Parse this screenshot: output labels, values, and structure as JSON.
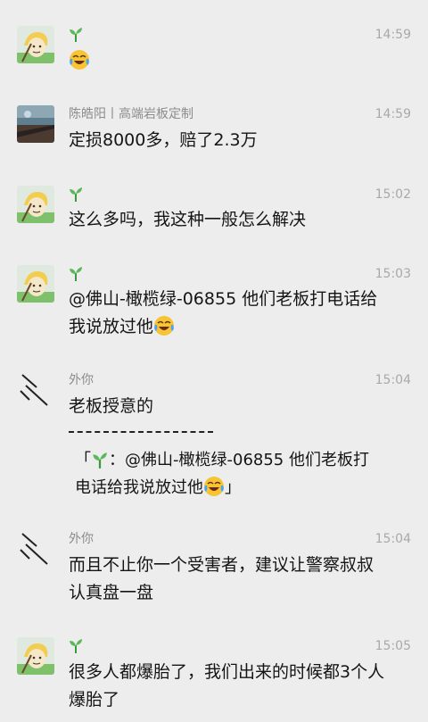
{
  "messages": [
    {
      "avatar": "farmer-avatar",
      "name_icon": "sprout-icon",
      "time": "14:59",
      "text": "",
      "emoji_only": true
    },
    {
      "avatar": "photo-avatar",
      "name": "陈皓阳丨高端岩板定制",
      "time": "14:59",
      "text": "定损8000多，赔了2.3万"
    },
    {
      "avatar": "farmer-avatar",
      "name_icon": "sprout-icon",
      "time": "15:02",
      "text": "这么多吗，我这种一般怎么解决"
    },
    {
      "avatar": "farmer-avatar",
      "name_icon": "sprout-icon",
      "time": "15:03",
      "line1": "@佛山-橄榄绿-06855 他们老板打电话给",
      "line2": "我说放过他"
    },
    {
      "avatar": "slash-avatar",
      "name": "外你",
      "time": "15:04",
      "text": "老板授意的",
      "quote_line1": "：@佛山-橄榄绿-06855 他们老板打",
      "quote_line2": "电话给我说放过他",
      "quote_open": "「",
      "quote_close": "」"
    },
    {
      "avatar": "slash-avatar",
      "name": "外你",
      "time": "15:04",
      "line1": "而且不止你一个受害者，建议让警察叔叔",
      "line2": "认真盘一盘"
    },
    {
      "avatar": "farmer-avatar",
      "name_icon": "sprout-icon",
      "time": "15:05",
      "line1": "很多人都爆胎了，我们出来的时候都3个人",
      "line2": "爆胎了"
    }
  ],
  "emoji": "laughing-crying-emoji"
}
